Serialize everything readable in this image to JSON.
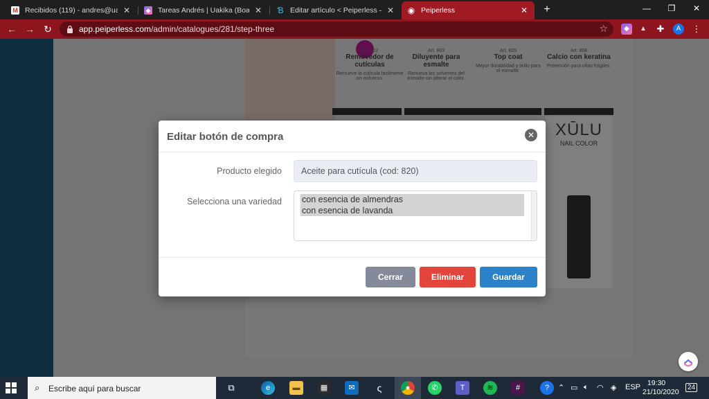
{
  "browser": {
    "tabs": [
      {
        "title": "Recibidos (119) - andres@uakika",
        "favicon": "gmail-icon"
      },
      {
        "title": "Tareas Andrés | Uakika (Board)",
        "favicon": "clickup-icon"
      },
      {
        "title": "Editar artículo < Peiperless — W",
        "favicon": "wordpress-icon"
      },
      {
        "title": "Peiperless",
        "favicon": "globe-icon"
      }
    ],
    "new_tab": "+",
    "address": {
      "host": "app.peiperless.com",
      "path": "/admin/catalogues/281/step-three"
    },
    "profile_initial": "A"
  },
  "colors": {
    "tab_active": "#a01a24",
    "address_bar": "#8e141d",
    "btn_close": "#848a99",
    "btn_delete": "#e3443b",
    "btn_save": "#2c82c9"
  },
  "catalog": {
    "columns": [
      {
        "ref": "Art. 802",
        "title": "Removedor de cutículas",
        "desc": "Remueve la cutícula facilmente sin esfuerzo."
      },
      {
        "ref": "Art. 803",
        "title": "Diluyente para esmalte",
        "desc": "Renueva los solventes del esmalte sin alterar el color."
      },
      {
        "ref": "Art. 805",
        "title": "Top coat",
        "desc": "Mayor durabilidad y brillo para el esmalte."
      },
      {
        "ref": "Art. 806",
        "title": "Calcio con keratina",
        "desc": "Protección para uñas frágiles."
      }
    ],
    "brand": "XŪLU",
    "brand_sub": "NAIL COLOR"
  },
  "modal": {
    "title": "Editar botón de compra",
    "product_label": "Producto elegido",
    "product_value": "Aceite para cutícula  (cod: 820)",
    "variety_label": "Selecciona una variedad",
    "varieties": [
      "con esencia de almendras",
      "con esencia de lavanda"
    ],
    "buttons": {
      "close": "Cerrar",
      "delete": "Eliminar",
      "save": "Guardar"
    }
  },
  "taskbar": {
    "search_placeholder": "Escribe aquí para buscar",
    "language": "ESP",
    "time": "19:30",
    "date": "21/10/2020",
    "notifications": "24"
  }
}
